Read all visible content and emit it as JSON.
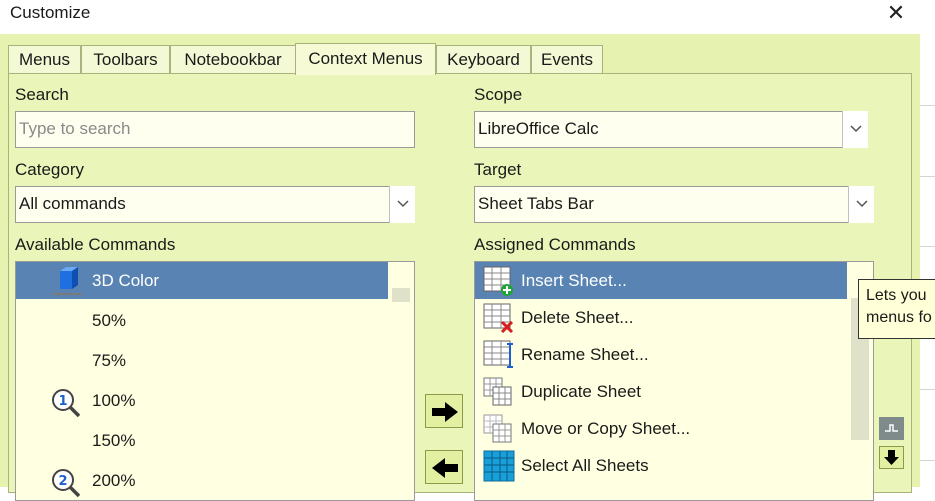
{
  "window": {
    "title": "Customize",
    "close_glyph": "✕"
  },
  "tabs": [
    {
      "label": "Menus"
    },
    {
      "label": "Toolbars"
    },
    {
      "label": "Notebookbar"
    },
    {
      "label": "Context Menus",
      "active": true
    },
    {
      "label": "Keyboard"
    },
    {
      "label": "Events"
    }
  ],
  "search": {
    "label": "Search",
    "placeholder": "Type to search",
    "value": ""
  },
  "category": {
    "label": "Category",
    "value": "All commands"
  },
  "scope": {
    "label": "Scope",
    "value": "LibreOffice Calc"
  },
  "target": {
    "label": "Target",
    "value": "Sheet Tabs Bar"
  },
  "available": {
    "label": "Available Commands",
    "items": [
      {
        "label": "3D Color",
        "icon": "3d-color-icon",
        "selected": true
      },
      {
        "label": "50%",
        "icon": ""
      },
      {
        "label": "75%",
        "icon": ""
      },
      {
        "label": "100%",
        "icon": "zoom-100-icon"
      },
      {
        "label": "150%",
        "icon": ""
      },
      {
        "label": "200%",
        "icon": "zoom-200-icon"
      }
    ]
  },
  "assigned": {
    "label": "Assigned Commands",
    "items": [
      {
        "label": "Insert Sheet...",
        "icon": "insert-sheet-icon",
        "selected": true
      },
      {
        "label": "Delete Sheet...",
        "icon": "delete-sheet-icon"
      },
      {
        "label": "Rename Sheet...",
        "icon": "rename-sheet-icon"
      },
      {
        "label": "Duplicate Sheet",
        "icon": "duplicate-sheet-icon"
      },
      {
        "label": "Move or Copy Sheet...",
        "icon": "move-copy-sheet-icon"
      },
      {
        "label": "Select All Sheets",
        "icon": "select-all-sheets-icon"
      }
    ]
  },
  "buttons": {
    "add_icon": "arrow-right-icon",
    "remove_icon": "arrow-left-icon",
    "move_up_icon": "move-up-icon",
    "move_down_icon": "arrow-down-icon"
  },
  "tooltip": {
    "line1": "Lets you",
    "line2": "menus fo"
  },
  "colors": {
    "dialog_bg": "#e6f3b0",
    "selection": "#5883b2",
    "list_bg": "#ffffe1",
    "field_bg": "#fffff0"
  }
}
